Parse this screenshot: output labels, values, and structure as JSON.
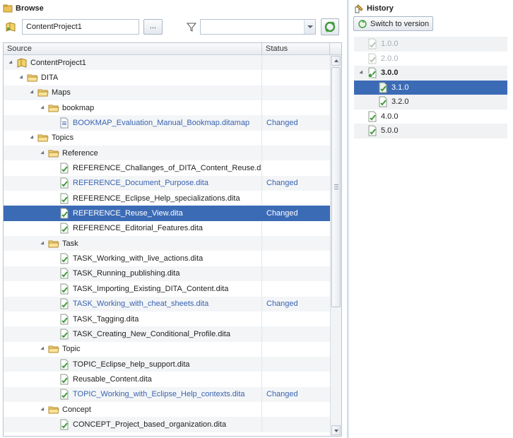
{
  "browse": {
    "title": "Browse",
    "project_value": "ContentProject1",
    "browse_button_label": "...",
    "filter_value": "",
    "columns": {
      "source": "Source",
      "status": "Status"
    },
    "rows": [
      {
        "label": "ContentProject1",
        "depth": 0,
        "icon": "project-icon",
        "status": "",
        "expanded": true
      },
      {
        "label": "DITA",
        "depth": 1,
        "icon": "folder-icon",
        "status": "",
        "expanded": true
      },
      {
        "label": "Maps",
        "depth": 2,
        "icon": "folder-icon",
        "status": "",
        "expanded": true
      },
      {
        "label": "bookmap",
        "depth": 3,
        "icon": "folder-icon",
        "status": "",
        "expanded": true
      },
      {
        "label": "BOOKMAP_Evaluation_Manual_Bookmap.ditamap",
        "depth": 4,
        "icon": "map-file-icon",
        "status": "Changed"
      },
      {
        "label": "Topics",
        "depth": 2,
        "icon": "folder-icon",
        "status": "",
        "expanded": true
      },
      {
        "label": "Reference",
        "depth": 3,
        "icon": "folder-icon",
        "status": "",
        "expanded": true
      },
      {
        "label": "REFERENCE_Challanges_of_DITA_Content_Reuse.dita",
        "depth": 4,
        "icon": "topic-file-icon",
        "status": ""
      },
      {
        "label": "REFERENCE_Document_Purpose.dita",
        "depth": 4,
        "icon": "topic-file-icon",
        "status": "Changed"
      },
      {
        "label": "REFERENCE_Eclipse_Help_specializations.dita",
        "depth": 4,
        "icon": "topic-file-icon",
        "status": ""
      },
      {
        "label": "REFERENCE_Reuse_View.dita",
        "depth": 4,
        "icon": "topic-file-icon",
        "status": "Changed",
        "selected": true
      },
      {
        "label": "REFERENCE_Editorial_Features.dita",
        "depth": 4,
        "icon": "topic-file-icon",
        "status": ""
      },
      {
        "label": "Task",
        "depth": 3,
        "icon": "folder-icon",
        "status": "",
        "expanded": true
      },
      {
        "label": "TASK_Working_with_live_actions.dita",
        "depth": 4,
        "icon": "topic-file-icon",
        "status": ""
      },
      {
        "label": "TASK_Running_publishing.dita",
        "depth": 4,
        "icon": "topic-file-icon",
        "status": ""
      },
      {
        "label": "TASK_Importing_Existing_DITA_Content.dita",
        "depth": 4,
        "icon": "topic-file-icon",
        "status": ""
      },
      {
        "label": "TASK_Working_with_cheat_sheets.dita",
        "depth": 4,
        "icon": "topic-file-icon",
        "status": "Changed"
      },
      {
        "label": "TASK_Tagging.dita",
        "depth": 4,
        "icon": "topic-file-icon",
        "status": ""
      },
      {
        "label": "TASK_Creating_New_Conditional_Profile.dita",
        "depth": 4,
        "icon": "topic-file-icon",
        "status": ""
      },
      {
        "label": "Topic",
        "depth": 3,
        "icon": "folder-icon",
        "status": "",
        "expanded": true
      },
      {
        "label": "TOPIC_Eclipse_help_support.dita",
        "depth": 4,
        "icon": "topic-file-icon",
        "status": ""
      },
      {
        "label": "Reusable_Content.dita",
        "depth": 4,
        "icon": "topic-file-icon",
        "status": ""
      },
      {
        "label": "TOPIC_Working_with_Eclipse_Help_contexts.dita",
        "depth": 4,
        "icon": "topic-file-icon",
        "status": "Changed"
      },
      {
        "label": "Concept",
        "depth": 3,
        "icon": "folder-icon",
        "status": "",
        "expanded": true
      },
      {
        "label": "CONCEPT_Project_based_organization.dita",
        "depth": 4,
        "icon": "topic-file-icon",
        "status": ""
      }
    ]
  },
  "history": {
    "title": "History",
    "switch_button_label": "Switch to version",
    "versions": [
      {
        "label": "1.0.0",
        "depth": 0,
        "disabled": true
      },
      {
        "label": "2.0.0",
        "depth": 0,
        "disabled": true
      },
      {
        "label": "3.0.0",
        "depth": 0,
        "bold": true,
        "expanded": true,
        "current": true
      },
      {
        "label": "3.1.0",
        "depth": 1,
        "selected": true
      },
      {
        "label": "3.2.0",
        "depth": 1
      },
      {
        "label": "4.0.0",
        "depth": 0
      },
      {
        "label": "5.0.0",
        "depth": 0
      }
    ]
  },
  "colors": {
    "selection": "#3c6bb6",
    "changed_text": "#3a63b0",
    "row_alt": "#f3f5f7",
    "disabled_text": "#a7adb4"
  }
}
